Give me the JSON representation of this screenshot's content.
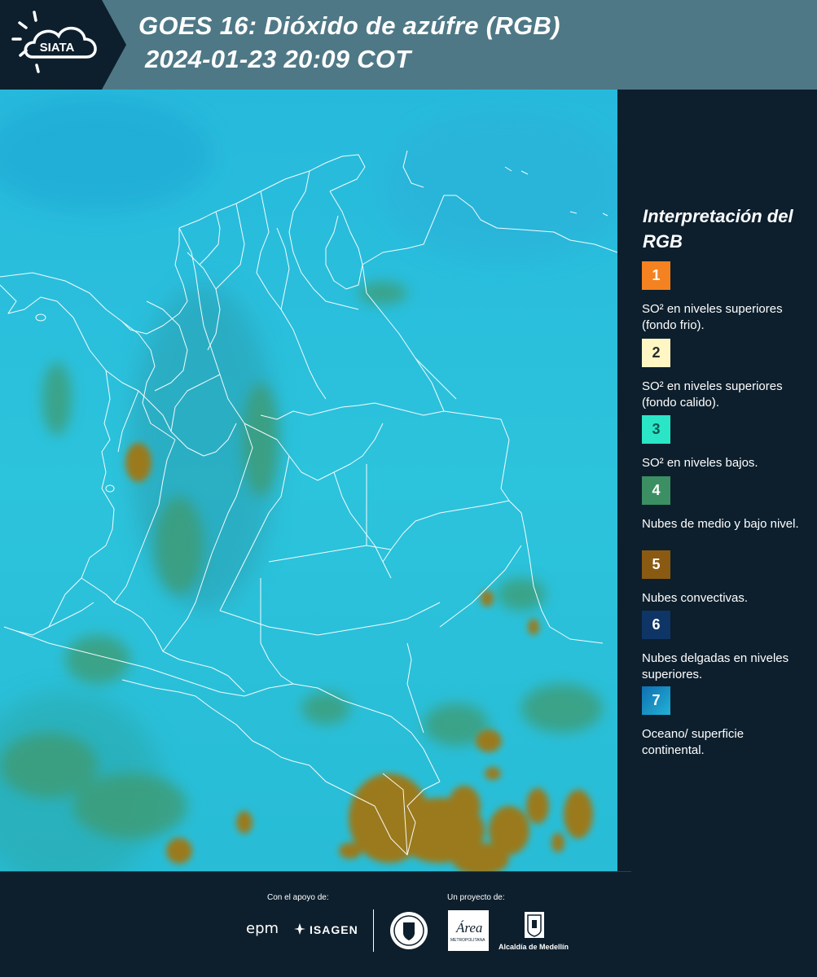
{
  "header": {
    "logo_text": "SIATA",
    "title_line1": "GOES 16: Dióxido de azúfre (RGB)",
    "title_line2": "2024-01-23 20:09 COT"
  },
  "legend": {
    "title": "Interpretación del RGB",
    "items": [
      {
        "number": "1",
        "color": "#f58220",
        "text_color": "#ffffff",
        "label": "SO² en niveles superiores (fondo frio)."
      },
      {
        "number": "2",
        "color": "#fff6c4",
        "text_color": "#2b2b2b",
        "label": "SO² en niveles superiores (fondo calido)."
      },
      {
        "number": "3",
        "color": "#2ae6c6",
        "text_color": "#0f5a55",
        "label": "SO² en niveles bajos."
      },
      {
        "number": "4",
        "color": "#3b8f63",
        "text_color": "#ffffff",
        "label": "Nubes de medio y bajo nivel."
      },
      {
        "number": "5",
        "color": "#8a5a12",
        "text_color": "#ffffff",
        "label": "Nubes convectivas."
      },
      {
        "number": "6",
        "color": "#0e3566",
        "text_color": "#ffffff",
        "label": "Nubes delgadas en niveles superiores."
      },
      {
        "number": "7",
        "color": "#1a8fc4",
        "text_color": "#ffffff",
        "label": "Oceano/ superficie continental."
      }
    ]
  },
  "footer": {
    "support_label": "Con el apoyo de:",
    "project_label": "Un proyecto de:",
    "epm_logo": "epm",
    "isagen_logo": "ISAGEN",
    "area_logo": "Área",
    "area_sub": "METROPOLITANA",
    "alcaldia_logo": "Alcaldía de Medellín"
  },
  "colors": {
    "header_bg": "#4f7886",
    "panel_bg": "#0d1f2d",
    "map_base": "#27c3de"
  }
}
